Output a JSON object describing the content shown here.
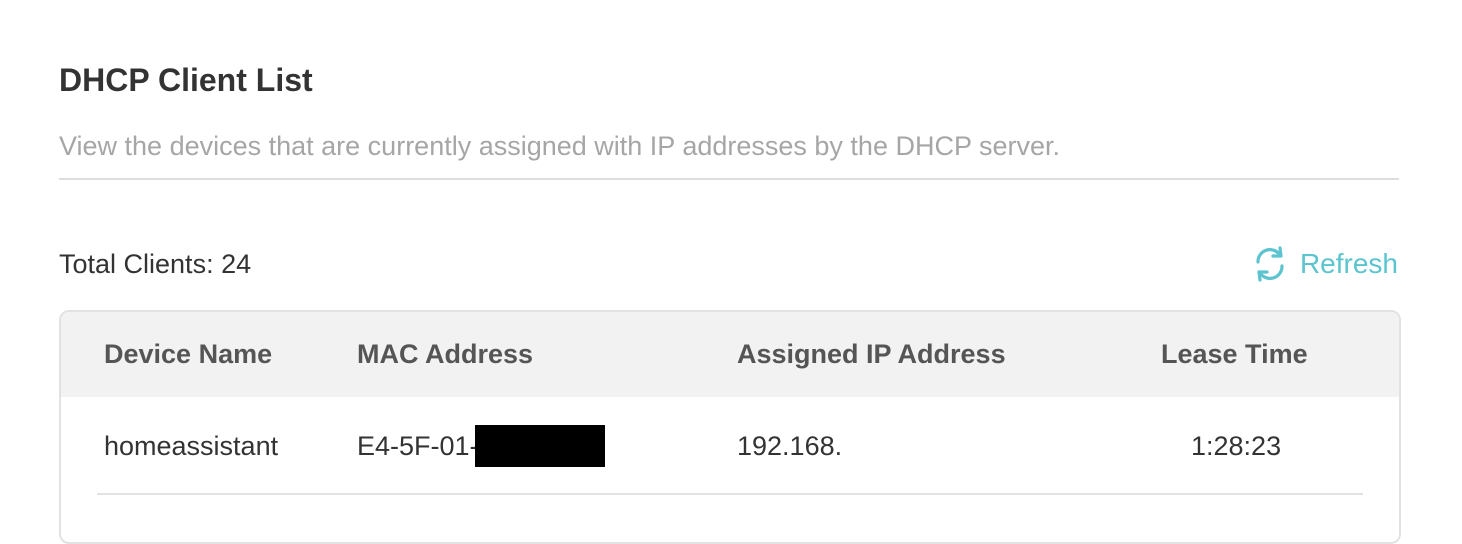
{
  "section": {
    "title": "DHCP Client List",
    "description": "View the devices that are currently assigned with IP addresses by the DHCP server."
  },
  "summary": {
    "total_clients_text": "Total Clients: 24"
  },
  "toolbar": {
    "refresh_label": "Refresh",
    "refresh_icon": "refresh-icon"
  },
  "colors": {
    "accent": "#5bc4cf",
    "header_bg": "#f2f2f2",
    "muted_text": "#a6a6a6"
  },
  "table": {
    "columns": [
      "Device Name",
      "MAC Address",
      "Assigned IP Address",
      "Lease Time"
    ],
    "rows": [
      {
        "device_name": "homeassistant",
        "mac_address": "E4-5F-01-",
        "mac_redacted": true,
        "ip_address": "192.168.",
        "lease_time": "1:28:23"
      }
    ]
  }
}
